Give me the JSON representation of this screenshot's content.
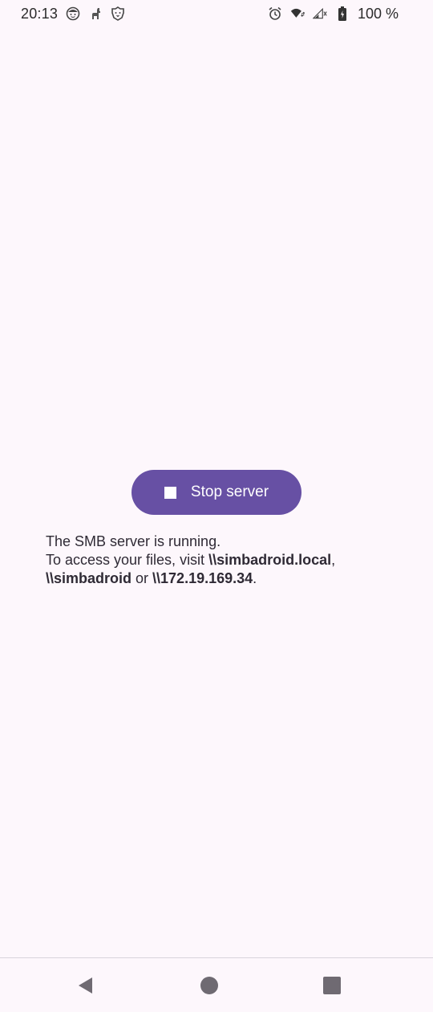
{
  "status_bar": {
    "time": "20:13",
    "battery_percent": "100 %",
    "notification_icons": [
      "face-icon",
      "llama-icon",
      "lion-icon"
    ],
    "system_icons": [
      "alarm-icon",
      "wifi-icon",
      "signal-icon",
      "battery-icon"
    ]
  },
  "main": {
    "stop_button_label": "Stop server",
    "status_line": "The SMB server is running.",
    "access_prefix": "To access your files, visit ",
    "address_local": "\\\\simbadroid.local",
    "separator_comma": ",",
    "address_host": "\\\\simbadroid",
    "word_or": " or ",
    "address_ip": "\\\\172.19.169.34",
    "period": "."
  },
  "nav_bar": {
    "buttons": [
      "back-button",
      "home-button",
      "recents-button"
    ]
  },
  "colors": {
    "background": "#fdf7fc",
    "accent": "#6750a4",
    "text": "#2f2a35"
  }
}
